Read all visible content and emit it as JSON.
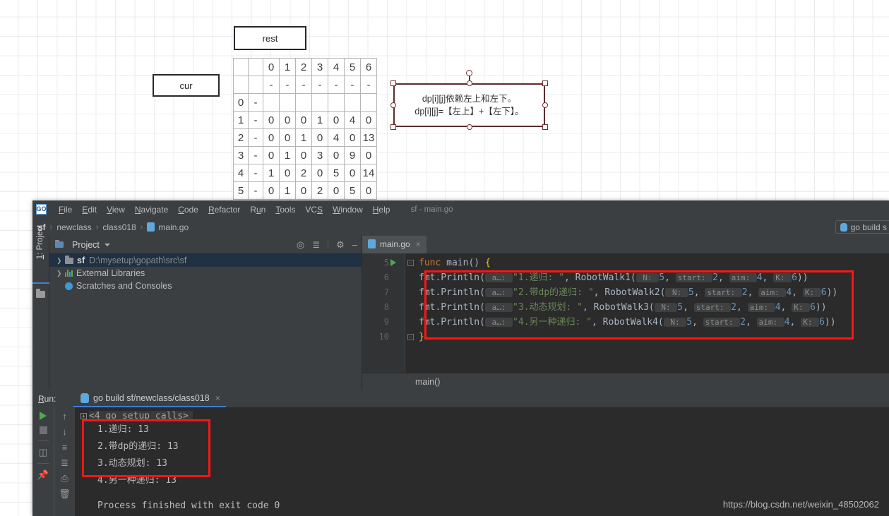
{
  "diagram": {
    "box_rest": "rest",
    "box_cur": "cur",
    "callout_line1": "dp[i][j]依赖左上和左下。",
    "callout_line2": "dp[i][j]=【左上】+【左下】。",
    "border_color": "#5c2c2c"
  },
  "dp_table": {
    "rows": [
      [
        "",
        "",
        "0",
        "1",
        "2",
        "3",
        "4",
        "5",
        "6"
      ],
      [
        "",
        "",
        "-",
        "-",
        "-",
        "-",
        "-",
        "-",
        "-"
      ],
      [
        "0",
        "-",
        "",
        "",
        "",
        "",
        "",
        "",
        ""
      ],
      [
        "1",
        "-",
        "0",
        "0",
        "0",
        "1",
        "0",
        "4",
        "0"
      ],
      [
        "2",
        "-",
        "0",
        "0",
        "1",
        "0",
        "4",
        "0",
        "13"
      ],
      [
        "3",
        "-",
        "0",
        "1",
        "0",
        "3",
        "0",
        "9",
        "0"
      ],
      [
        "4",
        "-",
        "1",
        "0",
        "2",
        "0",
        "5",
        "0",
        "14"
      ],
      [
        "5",
        "-",
        "0",
        "1",
        "0",
        "2",
        "0",
        "5",
        "0"
      ]
    ]
  },
  "ide": {
    "logo": "go-logo-icon",
    "window_title": "sf - main.go",
    "menu": [
      {
        "pre": "",
        "mn": "F",
        "post": "ile"
      },
      {
        "pre": "",
        "mn": "E",
        "post": "dit"
      },
      {
        "pre": "",
        "mn": "V",
        "post": "iew"
      },
      {
        "pre": "",
        "mn": "N",
        "post": "avigate"
      },
      {
        "pre": "",
        "mn": "C",
        "post": "ode"
      },
      {
        "pre": "",
        "mn": "R",
        "post": "efactor"
      },
      {
        "pre": "R",
        "mn": "u",
        "post": "n"
      },
      {
        "pre": "",
        "mn": "T",
        "post": "ools"
      },
      {
        "pre": "VC",
        "mn": "S",
        "post": ""
      },
      {
        "pre": "",
        "mn": "W",
        "post": "indow"
      },
      {
        "pre": "",
        "mn": "H",
        "post": "elp"
      }
    ],
    "breadcrumbs": [
      "sf",
      "newclass",
      "class018",
      "main.go"
    ],
    "run_config": "go build s",
    "left_tab": {
      "pre": "",
      "mn": "1",
      "post": ": Project"
    },
    "project_panel": {
      "title": "Project",
      "icons": [
        "locate-icon",
        "collapse-all-icon",
        "gear-icon",
        "minimize-icon"
      ],
      "tree": [
        {
          "name": "sf",
          "path": "D:\\mysetup\\gopath\\src\\sf",
          "icon": "folder-icon",
          "selected": true,
          "arrow": "›"
        },
        {
          "name": "External Libraries",
          "path": "",
          "icon": "libraries-icon",
          "selected": false,
          "arrow": "›"
        },
        {
          "name": "Scratches and Consoles",
          "path": "",
          "icon": "scratches-icon",
          "selected": false,
          "arrow": ""
        }
      ]
    },
    "editor": {
      "tab_label": "main.go",
      "line_numbers": [
        "5",
        "6",
        "7",
        "8",
        "9",
        "10"
      ],
      "breadcrumb": "main()",
      "code": [
        {
          "no": "5",
          "segs": [
            {
              "t": "func ",
              "c": "kw"
            },
            {
              "t": "main",
              "c": "fn"
            },
            {
              "t": "() ",
              "c": "pln"
            },
            {
              "t": "{",
              "c": "brace"
            }
          ]
        },
        {
          "no": "6",
          "segs": [
            {
              "t": "    fmt.Println(",
              "c": "pln"
            },
            {
              "t": " a…: ",
              "c": "hint"
            },
            {
              "t": "\"1.递归: \"",
              "c": "str"
            },
            {
              "t": ", RobotWalk1(",
              "c": "pln"
            },
            {
              "t": " N: ",
              "c": "hint"
            },
            {
              "t": "5",
              "c": "num"
            },
            {
              "t": ", ",
              "c": "pln"
            },
            {
              "t": " start: ",
              "c": "hint"
            },
            {
              "t": "2",
              "c": "num"
            },
            {
              "t": ", ",
              "c": "pln"
            },
            {
              "t": " aim: ",
              "c": "hint"
            },
            {
              "t": "4",
              "c": "num"
            },
            {
              "t": ", ",
              "c": "pln"
            },
            {
              "t": " K: ",
              "c": "hint"
            },
            {
              "t": "6",
              "c": "num"
            },
            {
              "t": "))",
              "c": "pln"
            }
          ]
        },
        {
          "no": "7",
          "segs": [
            {
              "t": "    fmt.Println(",
              "c": "pln"
            },
            {
              "t": " a…: ",
              "c": "hint"
            },
            {
              "t": "\"2.带dp的递归: \"",
              "c": "str"
            },
            {
              "t": ", RobotWalk2(",
              "c": "pln"
            },
            {
              "t": " N: ",
              "c": "hint"
            },
            {
              "t": "5",
              "c": "num"
            },
            {
              "t": ", ",
              "c": "pln"
            },
            {
              "t": " start: ",
              "c": "hint"
            },
            {
              "t": "2",
              "c": "num"
            },
            {
              "t": ", ",
              "c": "pln"
            },
            {
              "t": " aim: ",
              "c": "hint"
            },
            {
              "t": "4",
              "c": "num"
            },
            {
              "t": ", ",
              "c": "pln"
            },
            {
              "t": " K: ",
              "c": "hint"
            },
            {
              "t": "6",
              "c": "num"
            },
            {
              "t": "))",
              "c": "pln"
            }
          ]
        },
        {
          "no": "8",
          "segs": [
            {
              "t": "    fmt.Println(",
              "c": "pln"
            },
            {
              "t": " a…: ",
              "c": "hint"
            },
            {
              "t": "\"3.动态规划: \"",
              "c": "str"
            },
            {
              "t": ", RobotWalk3(",
              "c": "pln"
            },
            {
              "t": " N: ",
              "c": "hint"
            },
            {
              "t": "5",
              "c": "num"
            },
            {
              "t": ", ",
              "c": "pln"
            },
            {
              "t": " start: ",
              "c": "hint"
            },
            {
              "t": "2",
              "c": "num"
            },
            {
              "t": ", ",
              "c": "pln"
            },
            {
              "t": " aim: ",
              "c": "hint"
            },
            {
              "t": "4",
              "c": "num"
            },
            {
              "t": ", ",
              "c": "pln"
            },
            {
              "t": " K: ",
              "c": "hint"
            },
            {
              "t": "6",
              "c": "num"
            },
            {
              "t": "))",
              "c": "pln"
            }
          ]
        },
        {
          "no": "9",
          "segs": [
            {
              "t": "    fmt.Println(",
              "c": "pln"
            },
            {
              "t": " a…: ",
              "c": "hint"
            },
            {
              "t": "\"4.另一种递归: \"",
              "c": "str"
            },
            {
              "t": ", RobotWalk4(",
              "c": "pln"
            },
            {
              "t": " N: ",
              "c": "hint"
            },
            {
              "t": "5",
              "c": "num"
            },
            {
              "t": ", ",
              "c": "pln"
            },
            {
              "t": " start: ",
              "c": "hint"
            },
            {
              "t": "2",
              "c": "num"
            },
            {
              "t": ", ",
              "c": "pln"
            },
            {
              "t": " aim: ",
              "c": "hint"
            },
            {
              "t": "4",
              "c": "num"
            },
            {
              "t": ", ",
              "c": "pln"
            },
            {
              "t": " K: ",
              "c": "hint"
            },
            {
              "t": "6",
              "c": "num"
            },
            {
              "t": "))",
              "c": "pln"
            }
          ]
        },
        {
          "no": "10",
          "segs": [
            {
              "t": "}",
              "c": "brace"
            }
          ]
        }
      ]
    },
    "run_window": {
      "label": {
        "mn": "R",
        "post": "un:"
      },
      "tab_title": "go build sf/newclass/class018",
      "close": "×",
      "setup_line": "<4 go setup calls>",
      "output": [
        "1.递归:  13",
        "2.带dp的递归:  13",
        "3.动态规划:  13",
        "4.另一种递归:  13"
      ],
      "process_line": "Process finished with exit code 0",
      "toolbar_a": [
        "rerun-icon",
        "stop-icon",
        "layout-icon",
        "pin-icon"
      ],
      "toolbar_b": [
        "up-arrow-icon",
        "down-arrow-icon",
        "soft-wrap-icon",
        "scroll-to-end-icon",
        "print-icon",
        "trash-icon"
      ]
    }
  },
  "watermark": "https://blog.csdn.net/weixin_48502062",
  "annotations": {
    "color": "#ff1414",
    "code_box": "red-highlight-rectangle-code",
    "output_box": "red-highlight-rectangle-output"
  }
}
